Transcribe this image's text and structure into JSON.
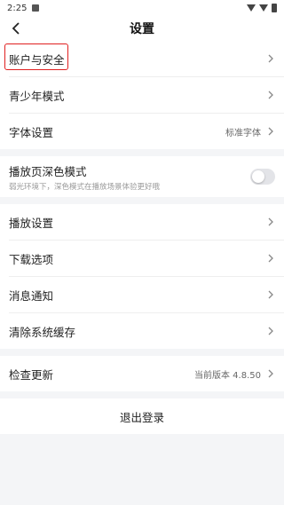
{
  "status_bar": {
    "time": "2:25"
  },
  "header": {
    "title": "设置"
  },
  "groups": {
    "account": {
      "label": "账户与安全"
    },
    "youth": {
      "label": "青少年模式"
    },
    "font": {
      "label": "字体设置",
      "value": "标准字体"
    },
    "dark": {
      "label": "播放页深色模式",
      "sub": "弱光环境下，深色模式在播放场景体验更好哦",
      "enabled": false
    },
    "play": {
      "label": "播放设置"
    },
    "download": {
      "label": "下载选项"
    },
    "notify": {
      "label": "消息通知"
    },
    "cache": {
      "label": "清除系统缓存"
    },
    "update": {
      "label": "检查更新",
      "value": "当前版本 4.8.50"
    }
  },
  "logout": {
    "label": "退出登录"
  },
  "colors": {
    "highlight": "#e02020",
    "background": "#f4f5f7"
  }
}
